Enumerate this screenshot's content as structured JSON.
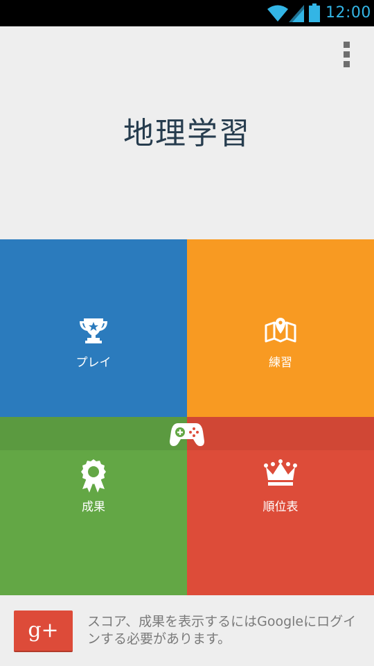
{
  "status_bar": {
    "time": "12:00",
    "icons": [
      "wifi-icon",
      "signal-icon",
      "battery-icon"
    ],
    "time_color": "#33b5e5"
  },
  "header": {
    "title": "地理学習",
    "overflow_icon": "more-vert-icon"
  },
  "tiles": {
    "play": {
      "label": "プレイ",
      "icon": "trophy-icon",
      "color": "#2b7bbd"
    },
    "practice": {
      "label": "練習",
      "icon": "map-icon",
      "color": "#f89a22"
    },
    "achievements": {
      "label": "成果",
      "icon": "award-ribbon-icon",
      "color": "#63a745"
    },
    "leaderboard": {
      "label": "順位表",
      "icon": "crown-icon",
      "color": "#dd4c39"
    }
  },
  "games_badge": {
    "icon": "gamepad-icon"
  },
  "signin": {
    "button_label": "g+",
    "message": "スコア、成果を表示するにはGoogleにログインする必要があります。"
  }
}
